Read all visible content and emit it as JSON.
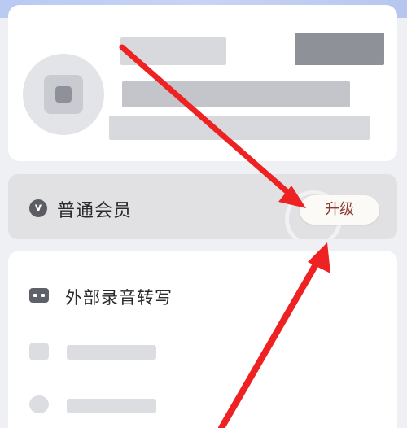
{
  "membership": {
    "icon": "v-badge-icon",
    "badge_letter": "v",
    "label": "普通会员",
    "upgrade_label": "升级"
  },
  "menu": {
    "items": [
      {
        "icon": "recorder-icon",
        "label": "外部录音转写"
      }
    ]
  },
  "colors": {
    "annotation_arrow": "#ee2222",
    "upgrade_text": "#8a3a2e"
  }
}
